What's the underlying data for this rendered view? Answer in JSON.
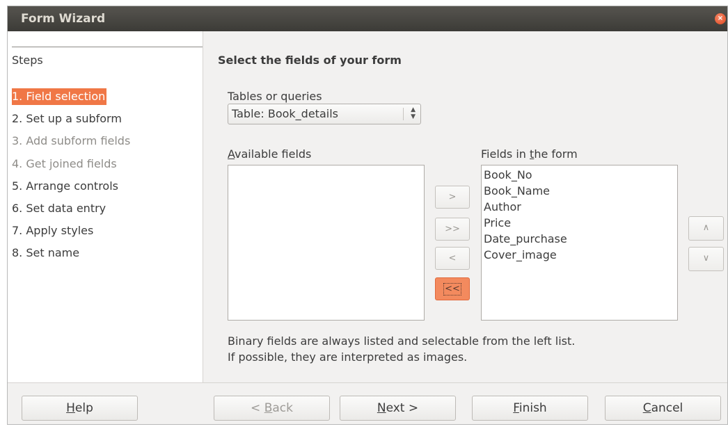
{
  "window": {
    "title": "Form Wizard",
    "close_glyph": "×"
  },
  "sidebar": {
    "title": "Steps",
    "steps": [
      {
        "label": "1. Field selection",
        "state": "active"
      },
      {
        "label": "2. Set up a subform",
        "state": "enabled"
      },
      {
        "label": "3. Add subform fields",
        "state": "disabled"
      },
      {
        "label": "4. Get joined fields",
        "state": "disabled"
      },
      {
        "label": "5. Arrange controls",
        "state": "enabled"
      },
      {
        "label": "6. Set data entry",
        "state": "enabled"
      },
      {
        "label": "7. Apply styles",
        "state": "enabled"
      },
      {
        "label": "8. Set name",
        "state": "enabled"
      }
    ]
  },
  "main": {
    "heading": "Select the fields of your form",
    "tables_label": "Tables or queries",
    "table_select": {
      "value": "Table: Book_details",
      "arrows": "⌃⌄"
    },
    "available": {
      "label_pre": "",
      "label_u": "A",
      "label_post": "vailable fields",
      "items": []
    },
    "in_form": {
      "label_pre": "Fields in ",
      "label_u": "t",
      "label_post": "he form",
      "items": [
        "Book_No",
        "Book_Name",
        "Author",
        "Price",
        "Date_purchase",
        "Cover_image"
      ]
    },
    "move_buttons": {
      "add_one": ">",
      "add_all": ">>",
      "remove_one": "<",
      "remove_all": "<<"
    },
    "order_buttons": {
      "up": "∧",
      "down": "∨"
    },
    "note_line1": "Binary fields are always listed and selectable from the left list.",
    "note_line2": "If possible, they are interpreted as images."
  },
  "footer": {
    "help": {
      "pre": "",
      "u": "H",
      "post": "elp"
    },
    "back": {
      "pre": "< ",
      "u": "B",
      "post": "ack"
    },
    "next": {
      "pre": "",
      "u": "N",
      "post": "ext >"
    },
    "finish": {
      "pre": "",
      "u": "F",
      "post": "inish"
    },
    "cancel": {
      "pre": "",
      "u": "C",
      "post": "ancel"
    }
  },
  "colors": {
    "accent": "#f07746",
    "titlebar": "#3c3b37",
    "window_bg": "#f2f1f0"
  }
}
